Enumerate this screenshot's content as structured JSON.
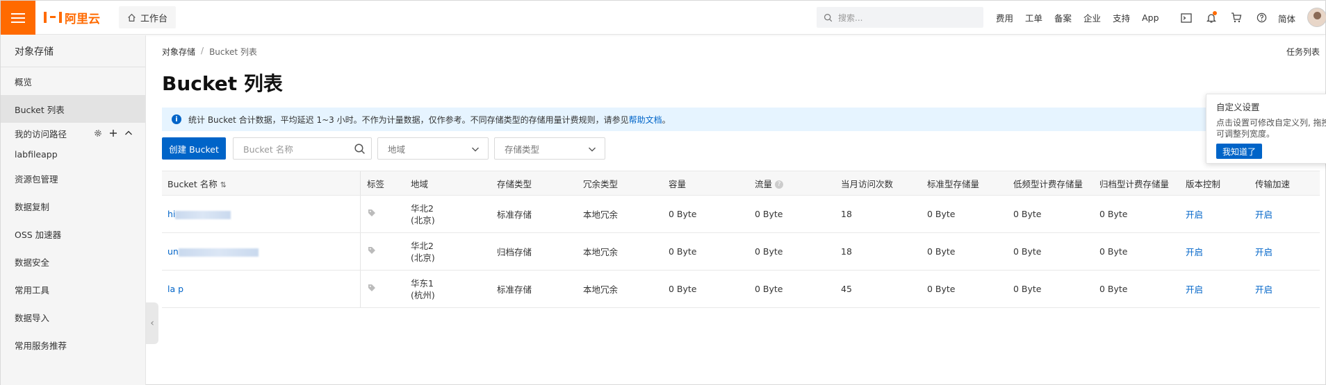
{
  "topbar": {
    "brand": "阿里云",
    "workbench": "工作台",
    "search_placeholder": "搜索...",
    "links": [
      "费用",
      "工单",
      "备案",
      "企业",
      "支持",
      "App"
    ],
    "lang": "简体"
  },
  "sidebar": {
    "title": "对象存储",
    "items_top": [
      "概览",
      "Bucket 列表"
    ],
    "group_label": "我的访问路径",
    "group_items": [
      "labfileapp"
    ],
    "items_bottom": [
      "资源包管理",
      "数据复制",
      "OSS 加速器",
      "数据安全",
      "常用工具",
      "数据导入",
      "常用服务推荐"
    ]
  },
  "breadcrumb": [
    "对象存储",
    "/",
    "Bucket 列表"
  ],
  "task_list": "任务列表",
  "page_title": "Bucket 列表",
  "notice": {
    "text": "统计 Bucket 合计数据，平均延迟 1~3 小时。不作为计量数据，仅作参考。不同存储类型的存储用量计费规则，请参见",
    "link": "帮助文档",
    "end": "。"
  },
  "toolbar": {
    "create_label": "创建 Bucket",
    "name_placeholder": "Bucket 名称",
    "region_placeholder": "地域",
    "storage_placeholder": "存储类型"
  },
  "popover": {
    "title": "自定义设置",
    "desc": "点击设置可修改自定义列, 拖拽Bucket名称可调整列宽度。",
    "button": "我知道了"
  },
  "table": {
    "headers": [
      "Bucket 名称",
      "标签",
      "地域",
      "存储类型",
      "冗余类型",
      "容量",
      "流量",
      "当月访问次数",
      "标准型存储量",
      "低频型计费存储量",
      "归档型计费存储量",
      "版本控制",
      "传输加速"
    ],
    "rows": [
      {
        "name": "hi",
        "region": [
          "华北2",
          "(北京)"
        ],
        "storage": "标准存储",
        "redundancy": "本地冗余",
        "capacity": "0 Byte",
        "traffic": "0 Byte",
        "visits": "18",
        "standard": "0 Byte",
        "ia": "0 Byte",
        "archive": "0 Byte",
        "versioning": "开启",
        "accel": "开启"
      },
      {
        "name": "un",
        "region": [
          "华北2",
          "(北京)"
        ],
        "storage": "归档存储",
        "redundancy": "本地冗余",
        "capacity": "0 Byte",
        "traffic": "0 Byte",
        "visits": "18",
        "standard": "0 Byte",
        "ia": "0 Byte",
        "archive": "0 Byte",
        "versioning": "开启",
        "accel": "开启"
      },
      {
        "name": "la  p",
        "region": [
          "华东1",
          "(杭州)"
        ],
        "storage": "标准存储",
        "redundancy": "本地冗余",
        "capacity": "0 Byte",
        "traffic": "0 Byte",
        "visits": "45",
        "standard": "0 Byte",
        "ia": "0 Byte",
        "archive": "0 Byte",
        "versioning": "开启",
        "accel": "开启"
      }
    ]
  },
  "colors": {
    "brand": "#ff6a00",
    "primary": "#0064c8",
    "notice_bg": "#e6f4ff"
  }
}
